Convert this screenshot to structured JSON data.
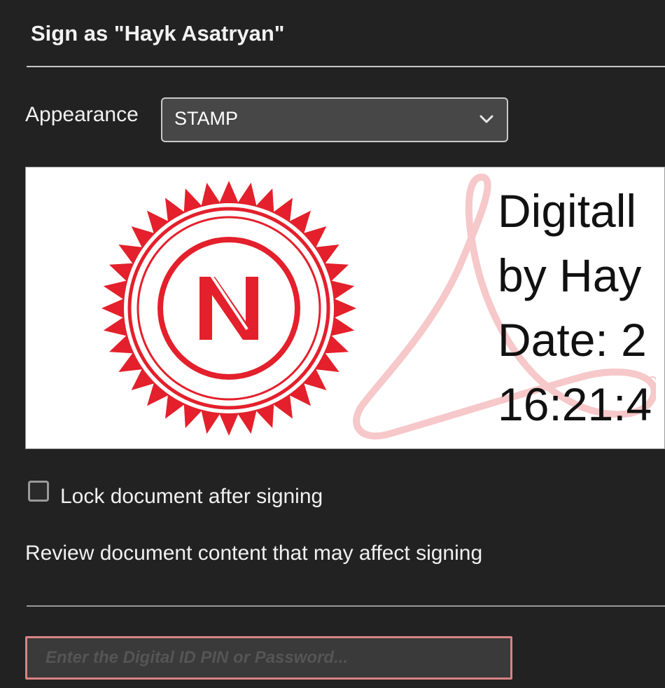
{
  "dialog": {
    "title": "Sign as \"Hayk Asatryan\""
  },
  "appearance": {
    "label": "Appearance",
    "selected": "STAMP"
  },
  "signature_preview": {
    "seal_letter": "N",
    "lines": [
      "Digitall",
      "by Hay",
      "Date: 2",
      "16:21:4"
    ],
    "seal_color": "#e3202b",
    "watermark_color": "#f6c8ca"
  },
  "lock_option": {
    "label": "Lock document after signing",
    "checked": false
  },
  "review": {
    "label": "Review document content that may affect signing"
  },
  "pin_field": {
    "placeholder": "Enter the Digital ID PIN or Password...",
    "value": "",
    "border_color": "#d98383"
  }
}
